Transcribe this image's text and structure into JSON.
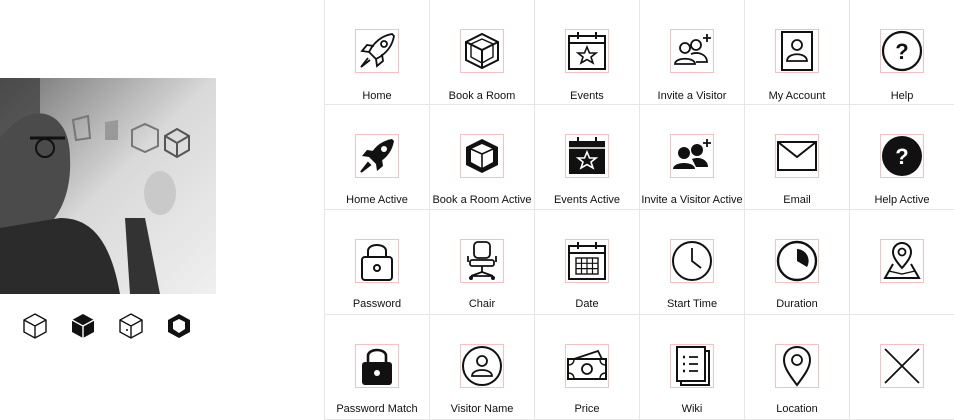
{
  "photo": {
    "alt": "Person drawing cube sketches on a whiteboard"
  },
  "cubes": [
    {
      "icon": "cube-outline-icon"
    },
    {
      "icon": "cube-filled-icon"
    },
    {
      "icon": "cube-door-icon"
    },
    {
      "icon": "cube-bold-icon"
    }
  ],
  "icons": [
    {
      "icon": "rocket-icon",
      "label": "Home"
    },
    {
      "icon": "cube-icon",
      "label": "Book a Room"
    },
    {
      "icon": "calendar-star-icon",
      "label": "Events"
    },
    {
      "icon": "add-users-icon",
      "label": "Invite a Visitor"
    },
    {
      "icon": "account-card-icon",
      "label": "My Account"
    },
    {
      "icon": "help-icon",
      "label": "Help"
    },
    {
      "icon": "rocket-filled-icon",
      "label": "Home Active"
    },
    {
      "icon": "cube-filled-icon",
      "label": "Book a Room Active"
    },
    {
      "icon": "calendar-star-filled-icon",
      "label": "Events Active"
    },
    {
      "icon": "add-users-filled-icon",
      "label": "Invite a Visitor Active"
    },
    {
      "icon": "envelope-icon",
      "label": "Email"
    },
    {
      "icon": "help-filled-icon",
      "label": "Help Active"
    },
    {
      "icon": "padlock-icon",
      "label": "Password"
    },
    {
      "icon": "office-chair-icon",
      "label": "Chair"
    },
    {
      "icon": "calendar-grid-icon",
      "label": "Date"
    },
    {
      "icon": "clock-icon",
      "label": "Start Time"
    },
    {
      "icon": "duration-pie-icon",
      "label": "Duration"
    },
    {
      "icon": "map-pin-icon",
      "label": ""
    },
    {
      "icon": "padlock-filled-icon",
      "label": "Password Match"
    },
    {
      "icon": "user-circle-icon",
      "label": "Visitor Name"
    },
    {
      "icon": "money-icon",
      "label": "Price"
    },
    {
      "icon": "wiki-book-icon",
      "label": "Wiki"
    },
    {
      "icon": "location-pin-icon",
      "label": "Location"
    },
    {
      "icon": "close-icon",
      "label": ""
    }
  ]
}
